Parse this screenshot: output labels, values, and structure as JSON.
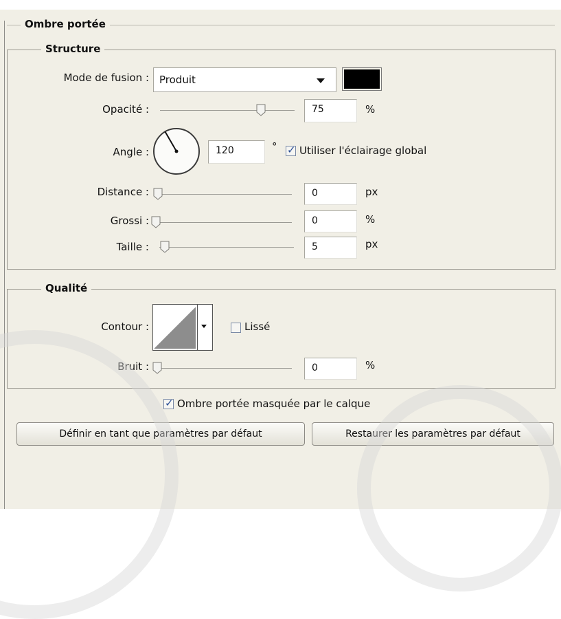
{
  "section_title": "Ombre portée",
  "structure": {
    "title": "Structure",
    "blend_mode_label": "Mode de fusion :",
    "blend_mode_value": "Produit",
    "color_swatch": "#000000",
    "opacity_label": "Opacité :",
    "opacity_value": "75",
    "opacity_unit": "%",
    "opacity_level": 0.75,
    "angle_label": "Angle :",
    "angle_value": "120",
    "angle_unit": "°",
    "global_light_label": "Utiliser l'éclairage global",
    "global_light_checked": true,
    "distance_label": "Distance :",
    "distance_value": "0",
    "distance_unit": "px",
    "spread_label": "Grossi :",
    "spread_value": "0",
    "spread_unit": "%",
    "size_label": "Taille :",
    "size_value": "5",
    "size_unit": "px"
  },
  "quality": {
    "title": "Qualité",
    "contour_label": "Contour :",
    "antialias_label": "Lissé",
    "antialias_checked": false,
    "noise_label": "Bruit :",
    "noise_value": "0",
    "noise_unit": "%"
  },
  "knockout_label": "Ombre portée masquée par le calque",
  "knockout_checked": true,
  "make_default_button": "Définir en tant que paramètres par défaut",
  "reset_default_button": "Restaurer les paramètres par défaut"
}
